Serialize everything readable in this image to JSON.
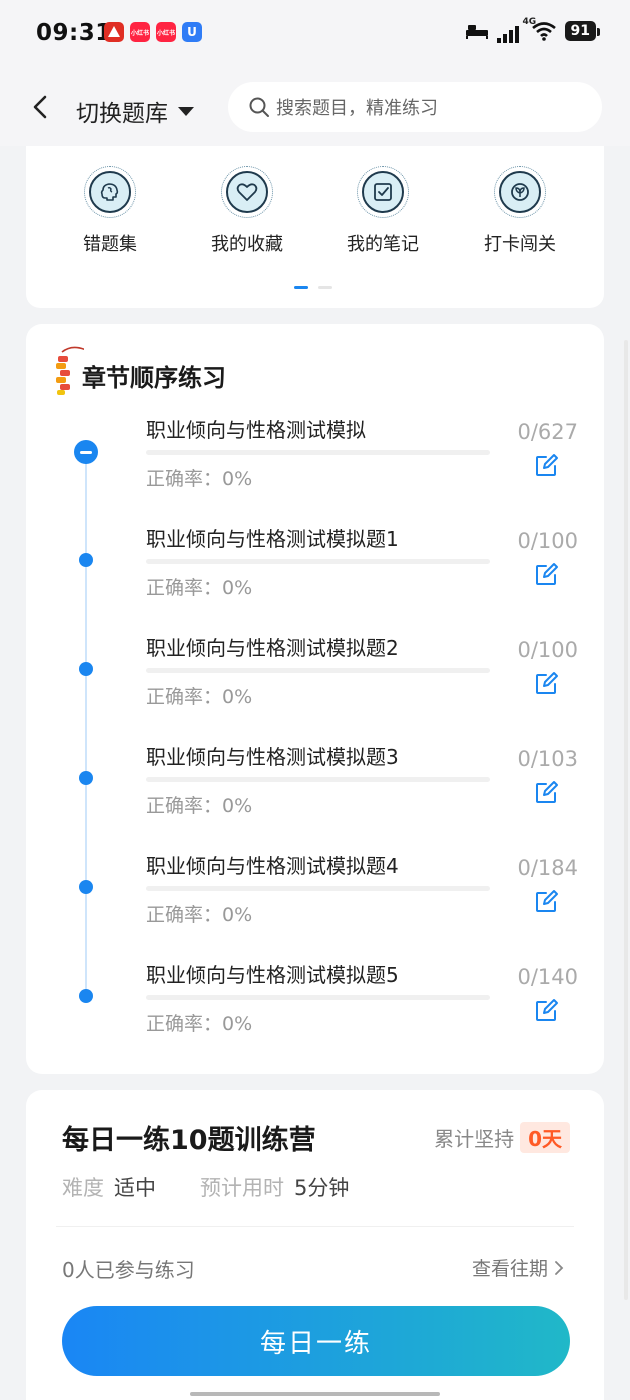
{
  "status_bar": {
    "time": "09:31",
    "network": "4G",
    "battery": "91",
    "app_icons": [
      {
        "name": "pinduoduo-icon",
        "color": "#e02e24",
        "label": ""
      },
      {
        "name": "xiaohongshu-icon",
        "color": "#ff2442",
        "label": "小红书"
      },
      {
        "name": "xiaohongshu-icon-2",
        "color": "#ff2442",
        "label": "小红书"
      },
      {
        "name": "app-u-icon",
        "color": "#2f7cf6",
        "label": "U"
      }
    ]
  },
  "header": {
    "switch_label": "切换题库",
    "search_placeholder": "搜索题目，精准练习"
  },
  "quick": {
    "items": [
      {
        "label": "错题集",
        "icon": "brain-icon"
      },
      {
        "label": "我的收藏",
        "icon": "heart-icon"
      },
      {
        "label": "我的笔记",
        "icon": "note-icon"
      },
      {
        "label": "打卡闯关",
        "icon": "leaf-icon"
      }
    ]
  },
  "chapter": {
    "title": "章节顺序练习",
    "rows": [
      {
        "title": "职业倾向与性格测试模拟",
        "accuracy": "正确率：0%",
        "count": "0/627",
        "current": true
      },
      {
        "title": "职业倾向与性格测试模拟题1",
        "accuracy": "正确率：0%",
        "count": "0/100",
        "current": false
      },
      {
        "title": "职业倾向与性格测试模拟题2",
        "accuracy": "正确率：0%",
        "count": "0/100",
        "current": false
      },
      {
        "title": "职业倾向与性格测试模拟题3",
        "accuracy": "正确率：0%",
        "count": "0/103",
        "current": false
      },
      {
        "title": "职业倾向与性格测试模拟题4",
        "accuracy": "正确率：0%",
        "count": "0/184",
        "current": false
      },
      {
        "title": "职业倾向与性格测试模拟题5",
        "accuracy": "正确率：0%",
        "count": "0/140",
        "current": false
      }
    ]
  },
  "daily": {
    "title": "每日一练10题训练营",
    "streak_label": "累计坚持",
    "streak_value": "0天",
    "difficulty_key": "难度",
    "difficulty_val": "适中",
    "time_key": "预计用时",
    "time_val": "5分钟",
    "participants": "0人已参与练习",
    "history_label": "查看往期",
    "cta_label": "每日一练"
  },
  "colors": {
    "accent": "#1a86f0",
    "streak": "#ff5a26"
  }
}
